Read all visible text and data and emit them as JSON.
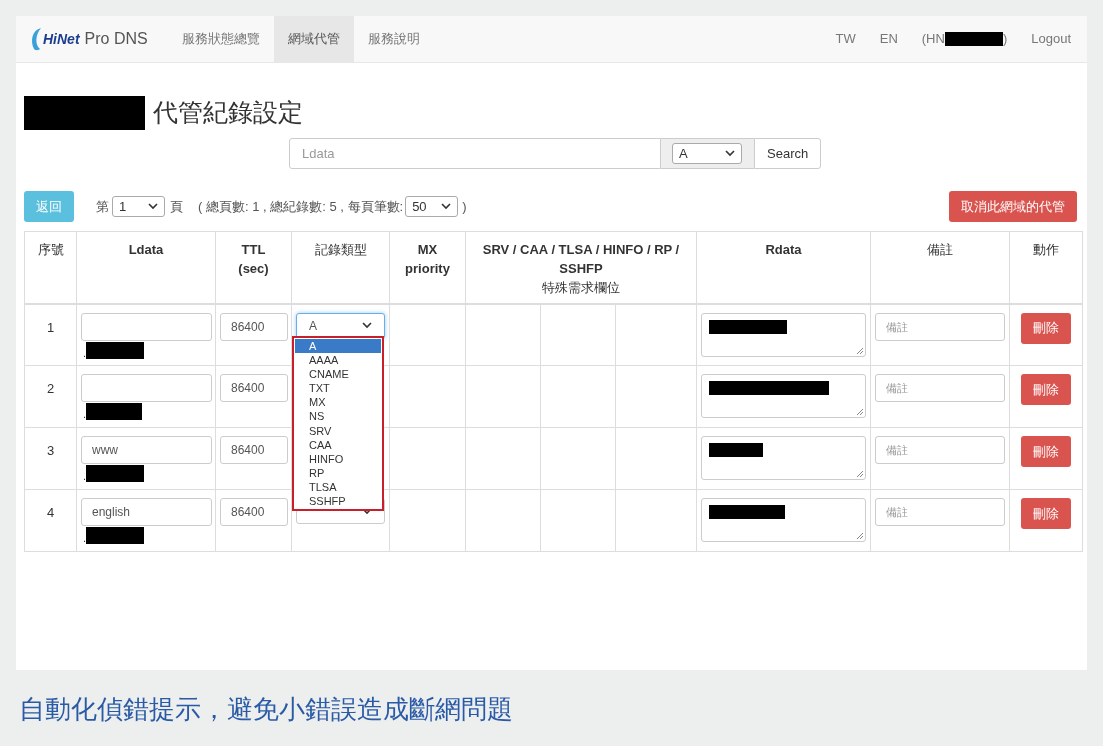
{
  "navbar": {
    "logo": "HiNet",
    "product": "Pro DNS",
    "items": [
      {
        "label": "服務狀態總覽",
        "selected": false
      },
      {
        "label": "網域代管",
        "selected": true
      },
      {
        "label": "服務說明",
        "selected": false
      }
    ],
    "languages": [
      "TW",
      "EN"
    ],
    "user_prefix": "(HN",
    "user_suffix": ")",
    "logout": "Logout"
  },
  "title": "代管紀錄設定",
  "search": {
    "placeholder": "Ldata",
    "type": "A",
    "button": "Search"
  },
  "toolbar": {
    "back": "返回",
    "page_before": "第",
    "page": "1",
    "page_after": "頁",
    "summary": "( 總頁數: 1 , 總紀錄數: 5 , 每頁筆數:",
    "per_page": "50",
    "summary_end": ")",
    "cancel": "取消此網域的代管"
  },
  "table": {
    "columns": [
      {
        "lines": [
          "序號"
        ],
        "bold": false
      },
      {
        "lines": [
          "Ldata"
        ],
        "bold": true
      },
      {
        "lines": [
          "TTL",
          "(sec)"
        ],
        "bold": true
      },
      {
        "lines": [
          "記錄類型"
        ],
        "bold": false
      },
      {
        "lines": [
          "MX",
          "priority"
        ],
        "bold": true
      },
      {
        "lines": [
          "SRV / CAA / TLSA / HINFO / RP /",
          "SSHFP"
        ],
        "bold": true,
        "subtitle": "特殊需求欄位"
      },
      {
        "lines": [
          "Rdata"
        ],
        "bold": true
      },
      {
        "lines": [
          "備註"
        ],
        "bold": false
      },
      {
        "lines": [
          "動作"
        ],
        "bold": false
      }
    ],
    "rows": [
      {
        "index": "1",
        "ldata": "",
        "domain_dot": ".",
        "ttl": "86400",
        "type": "A",
        "focused": true,
        "note_placeholder": "備註",
        "delete": "刪除"
      },
      {
        "index": "2",
        "ldata": "",
        "domain_dot": ".",
        "ttl": "86400",
        "note_placeholder": "備註",
        "delete": "刪除"
      },
      {
        "index": "3",
        "ldata": "www",
        "domain_dot": ".",
        "ttl": "86400",
        "note_placeholder": "備註",
        "delete": "刪除"
      },
      {
        "index": "4",
        "ldata": "english",
        "domain_dot": ".",
        "ttl": "86400",
        "focused": false,
        "note_placeholder": "備註",
        "delete": "刪除"
      }
    ],
    "dropdown": {
      "options": [
        {
          "label": "A",
          "selected": true
        },
        {
          "label": "AAAA",
          "selected": false
        },
        {
          "label": "CNAME",
          "selected": false
        },
        {
          "label": "TXT",
          "selected": false
        },
        {
          "label": "MX",
          "selected": false
        },
        {
          "label": "NS",
          "selected": false
        },
        {
          "label": "SRV",
          "selected": false
        },
        {
          "label": "CAA",
          "selected": false
        },
        {
          "label": "HINFO",
          "selected": false
        },
        {
          "label": "RP",
          "selected": false
        },
        {
          "label": "TLSA",
          "selected": false
        },
        {
          "label": "SSHFP",
          "selected": false
        }
      ]
    }
  },
  "caption": "自動化偵錯提示，避免小錯誤造成斷網問題"
}
